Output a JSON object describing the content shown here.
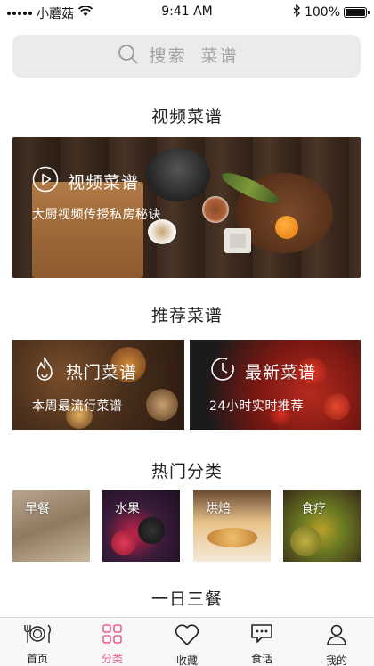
{
  "status_bar": {
    "carrier": "小蘑菇",
    "time": "9:41 AM",
    "battery": "100%",
    "battery_level": 1.0,
    "icons": [
      "signal-dots-icon",
      "wifi-icon",
      "bluetooth-icon",
      "battery-icon"
    ]
  },
  "search": {
    "placeholder": "搜索  菜谱",
    "icon": "search-icon"
  },
  "video_section": {
    "title": "视频菜谱",
    "banner": {
      "title": "视频菜谱",
      "subtitle": "大厨视频传授私房秘诀",
      "icon": "play-icon"
    }
  },
  "recommend_section": {
    "title": "推荐菜谱",
    "cards": [
      {
        "title": "热门菜谱",
        "subtitle": "本周最流行菜谱",
        "icon": "flame-icon"
      },
      {
        "title": "最新菜谱",
        "subtitle": "24小时实时推荐",
        "icon": "clock-icon"
      }
    ]
  },
  "hot_categories": {
    "title": "热门分类",
    "items": [
      {
        "label": "早餐"
      },
      {
        "label": "水果"
      },
      {
        "label": "烘焙"
      },
      {
        "label": "食疗"
      }
    ]
  },
  "meals_section": {
    "title": "一日三餐"
  },
  "tab_bar": {
    "active_color": "#e8628a",
    "items": [
      {
        "label": "首页",
        "icon": "fork-plate-knife-icon"
      },
      {
        "label": "分类",
        "icon": "grid-icon"
      },
      {
        "label": "收藏",
        "icon": "heart-icon"
      },
      {
        "label": "食话",
        "icon": "chat-bubble-icon"
      },
      {
        "label": "我的",
        "icon": "user-icon"
      }
    ],
    "active_index": 1
  }
}
